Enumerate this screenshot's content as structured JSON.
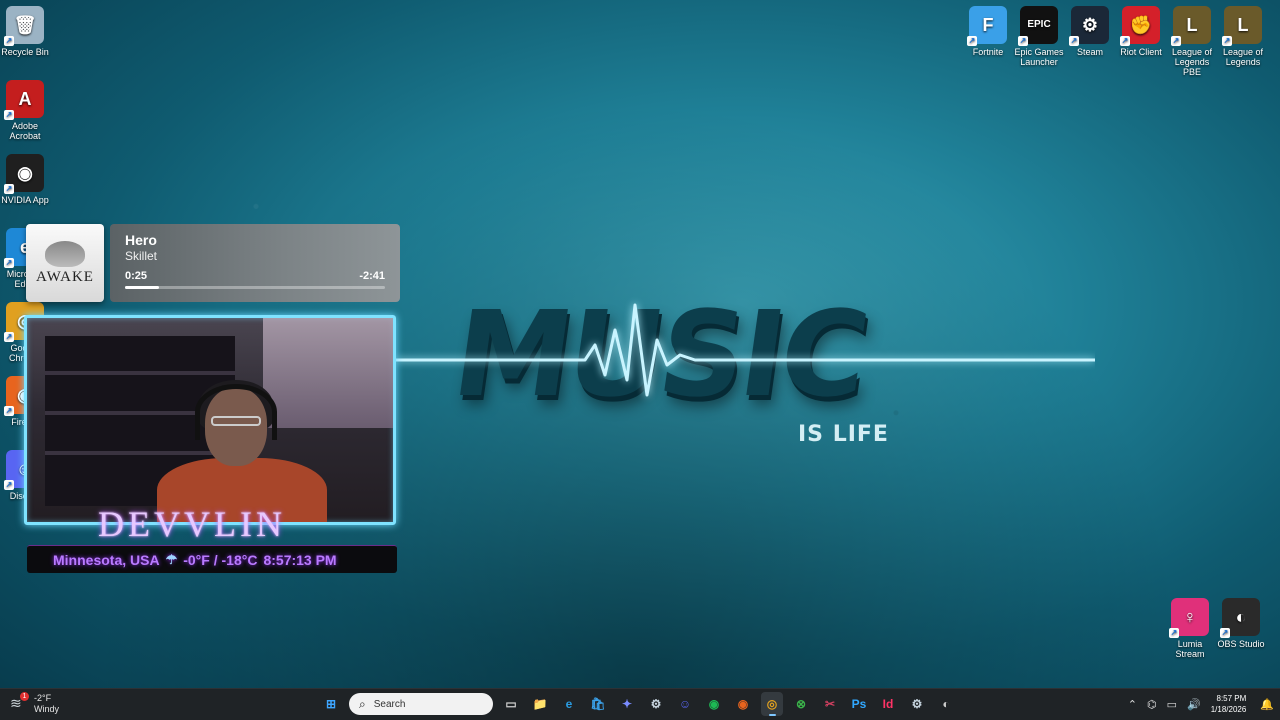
{
  "desktop_left": [
    {
      "id": "recycle-bin",
      "label": "Recycle Bin",
      "icon": "recycle-bin-icon",
      "glyph": "🗑",
      "color": "#9bb3c4"
    },
    {
      "id": "adobe-acrobat",
      "label": "Adobe Acrobat",
      "icon": "adobe-acrobat-icon",
      "glyph": "A",
      "color": "#c41e1e"
    },
    {
      "id": "nvidia-app",
      "label": "NVIDIA App",
      "icon": "nvidia-icon",
      "glyph": "◉",
      "color": "#1f1f1f"
    },
    {
      "id": "microsoft-edge",
      "label": "Microsoft Edge",
      "icon": "edge-icon",
      "glyph": "e",
      "color": "#1e88d6"
    },
    {
      "id": "google-chrome",
      "label": "Google Chrome",
      "icon": "chrome-icon",
      "glyph": "◎",
      "color": "#e0a020"
    },
    {
      "id": "firefox",
      "label": "Firefox",
      "icon": "firefox-icon",
      "glyph": "◉",
      "color": "#e8641e"
    },
    {
      "id": "discord",
      "label": "Discord",
      "icon": "discord-icon",
      "glyph": "☺",
      "color": "#5865f2"
    }
  ],
  "desktop_top_right": [
    {
      "id": "fortnite",
      "label": "Fortnite",
      "icon": "fortnite-icon",
      "glyph": "F",
      "color": "#3aa0e8"
    },
    {
      "id": "epic-games",
      "label": "Epic Games Launcher",
      "icon": "epic-games-icon",
      "glyph": "EPIC",
      "color": "#111111"
    },
    {
      "id": "steam",
      "label": "Steam",
      "icon": "steam-icon",
      "glyph": "⚙",
      "color": "#1b2838"
    },
    {
      "id": "riot-client",
      "label": "Riot Client",
      "icon": "riot-client-icon",
      "glyph": "✊",
      "color": "#d4202a"
    },
    {
      "id": "lol-pbe",
      "label": "League of Legends PBE",
      "icon": "league-pbe-icon",
      "glyph": "L",
      "color": "#6a5a2a"
    },
    {
      "id": "lol",
      "label": "League of Legends",
      "icon": "league-icon",
      "glyph": "L",
      "color": "#6a5a2a"
    }
  ],
  "desktop_bottom_right": [
    {
      "id": "lumia-stream",
      "label": "Lumia Stream",
      "icon": "lumia-stream-icon",
      "glyph": "♀",
      "color": "#e0307a"
    },
    {
      "id": "obs-studio",
      "label": "OBS Studio",
      "icon": "obs-studio-icon",
      "glyph": "◐",
      "color": "#2a2a2a"
    }
  ],
  "wallpaper": {
    "headline": "MUSIC",
    "tagline": "IS LIFE"
  },
  "now_playing": {
    "album": "AWAKE",
    "title": "Hero",
    "artist": "Skillet",
    "elapsed": "0:25",
    "remaining": "-2:41",
    "progress": 0.13
  },
  "webcam_overlay": {
    "name": "DEVVLIN",
    "location": "Minnesota, USA",
    "weather_icon": "☂",
    "temperature": "-0°F / -18°C",
    "time": "8:57:13 PM"
  },
  "taskbar": {
    "weather_temp": "-2°F",
    "weather_desc": "Windy",
    "weather_badge": "1",
    "search_placeholder": "Search",
    "apps": [
      {
        "id": "start",
        "icon": "windows-start-icon",
        "glyph": "⊞",
        "color": "#3ea6ff"
      },
      {
        "id": "task-view",
        "icon": "task-view-icon",
        "glyph": "▭",
        "color": "#cccccc"
      },
      {
        "id": "file-explorer",
        "icon": "file-explorer-icon",
        "glyph": "📁",
        "color": "#f2c14e"
      },
      {
        "id": "edge",
        "icon": "edge-icon",
        "glyph": "e",
        "color": "#2a9be0"
      },
      {
        "id": "store",
        "icon": "microsoft-store-icon",
        "glyph": "🛍",
        "color": "#3aa0e8"
      },
      {
        "id": "copilot",
        "icon": "copilot-icon",
        "glyph": "✦",
        "color": "#7a8cff"
      },
      {
        "id": "steam",
        "icon": "steam-icon",
        "glyph": "⚙",
        "color": "#c7d5e0"
      },
      {
        "id": "discord",
        "icon": "discord-icon",
        "glyph": "☺",
        "color": "#5865f2"
      },
      {
        "id": "spotify",
        "icon": "spotify-icon",
        "glyph": "◉",
        "color": "#1db954"
      },
      {
        "id": "firefox",
        "icon": "firefox-icon",
        "glyph": "◉",
        "color": "#e8641e"
      },
      {
        "id": "chrome",
        "icon": "chrome-icon",
        "glyph": "◎",
        "color": "#e0a020",
        "active": true
      },
      {
        "id": "xbox",
        "icon": "xbox-icon",
        "glyph": "⊗",
        "color": "#3bb24a"
      },
      {
        "id": "snipping",
        "icon": "snipping-tool-icon",
        "glyph": "✂",
        "color": "#d04060"
      },
      {
        "id": "photoshop",
        "icon": "photoshop-icon",
        "glyph": "Ps",
        "color": "#31a8ff"
      },
      {
        "id": "indesign",
        "icon": "indesign-icon",
        "glyph": "Id",
        "color": "#ff3366"
      },
      {
        "id": "steam-2",
        "icon": "steam-icon",
        "glyph": "⚙",
        "color": "#c7d5e0"
      },
      {
        "id": "obs",
        "icon": "obs-studio-icon",
        "glyph": "◐",
        "color": "#cccccc"
      }
    ],
    "clock_time": "8:57 PM",
    "clock_date": "1/18/2026"
  }
}
